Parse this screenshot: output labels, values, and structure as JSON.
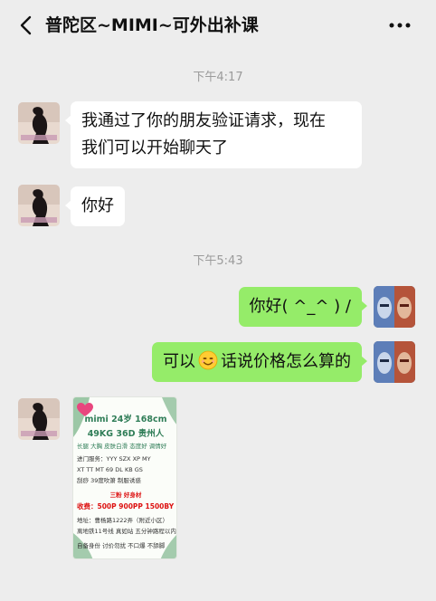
{
  "header": {
    "title": "普陀区~MIMI~可外出补课"
  },
  "messages": {
    "time1": "下午4:17",
    "msg1_line1": "我通过了你的朋友验证请求，现在",
    "msg1_line2": "我们可以开始聊天了",
    "msg2": "你好",
    "time2": "下午5:43",
    "msg3": "你好( ^_^ ) /",
    "msg4_before": "可以",
    "msg4_after": "话说价格怎么算的"
  },
  "image_card": {
    "line1": "mimi  24岁 168cm",
    "line2": "49KG 36D  贵州人",
    "line3": "长腿 大胸 皮肤白滑 态度好 调情好",
    "line4": "进门服务：YYY  SZX  XP  MY",
    "line5": "XT  TT MT  69  DL  KB  GS",
    "line6": "刮痧  39度吹箫 制服诱惑",
    "line7": "三粉    好身材",
    "line8": "收费：500P  900PP  1500BY",
    "line9": "地址：曹杨路1222弄（附近小区）",
    "line10": "离地铁11号线 真如站 五分钟路程以内",
    "line11": "自备身份 讨价勿扰 不口爆 不舔脚"
  },
  "colors": {
    "background": "#ededed",
    "bubble_self": "#95ec69",
    "bubble_other": "#ffffff",
    "timestamp": "#9b9b9b"
  },
  "icons": {
    "back": "chevron-left-icon",
    "more": "more-dots-icon",
    "emoji": "smile-emoji-icon"
  }
}
